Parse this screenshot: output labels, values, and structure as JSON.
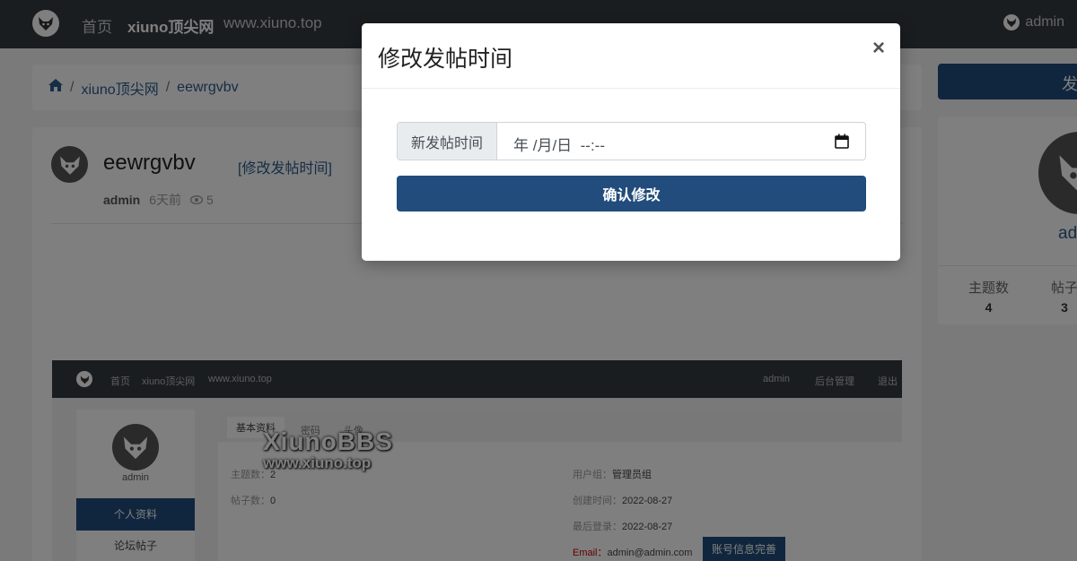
{
  "topnav": {
    "home": "首页",
    "site_name": "xiuno顶尖网",
    "site_url": "www.xiuno.top",
    "user": "admin"
  },
  "breadcrumb": {
    "separator": "/",
    "items": [
      "xiuno顶尖网",
      "eewrgvbv"
    ]
  },
  "post_button": "发",
  "thread": {
    "title": "eewrgvbv",
    "edit_link": "[修改发帖时间]",
    "author": "admin",
    "time": "6天前",
    "views": "5"
  },
  "embedded": {
    "nav": {
      "home": "首页",
      "site_name": "xiuno顶尖网",
      "site_url": "www.xiuno.top",
      "user": "admin",
      "admin_link": "后台管理",
      "logout": "退出"
    },
    "sidebar": {
      "name": "admin",
      "active_item": "个人资料",
      "item2": "论坛帖子"
    },
    "tabs": [
      "基本资料",
      "密码",
      "头像"
    ],
    "fields": {
      "threads_label": "主题数：",
      "threads_value": "2",
      "posts_label": "帖子数：",
      "posts_value": "0",
      "group_label": "用户组：",
      "group_value": "管理员组",
      "created_label": "创建时间：",
      "created_value": "2022-08-27",
      "last_label": "最后登录：",
      "last_value": "2022-08-27",
      "email_label": "Email：",
      "email_value": "admin@admin.com",
      "complete_button": "账号信息完善"
    },
    "watermark": {
      "line1": "XiunoBBS",
      "line2": "www.xiuno.top"
    }
  },
  "profile_card": {
    "name": "ad",
    "stats": [
      {
        "label": "主题数",
        "value": "4"
      },
      {
        "label": "帖子",
        "value": "3"
      }
    ]
  },
  "modal": {
    "title": "修改发帖时间",
    "close": "×",
    "input_label": "新发帖时间",
    "input_placeholder": "年 /月/日  --:--",
    "confirm": "确认修改"
  },
  "colors": {
    "nav_bg": "#343a40",
    "primary": "#214c7c",
    "link": "#2c5a8c"
  }
}
